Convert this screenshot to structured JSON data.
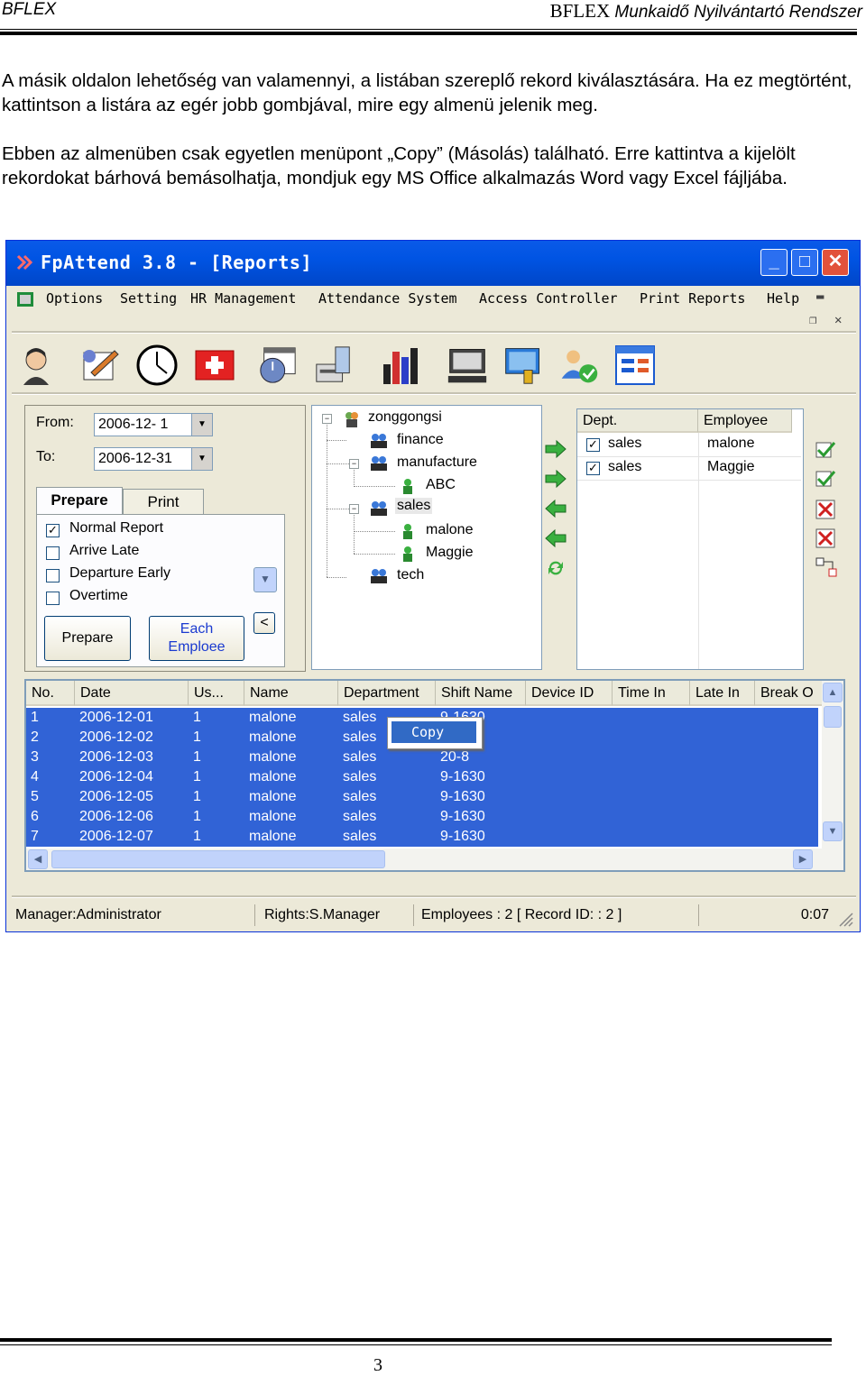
{
  "header": {
    "left": "BFLEX",
    "right_brand": "BFLEX",
    "right_sub": "Munkaidő Nyilvántartó Rendszer"
  },
  "paragraphs": [
    "A másik oldalon lehetőség van valamennyi, a listában szereplő rekord kiválasztására. Ha ez megtörtént, kattintson a listára az egér jobb gombjával, mire egy almenü jelenik meg.",
    "Ebben az almenüben csak egyetlen menüpont „Copy” (Másolás) található. Erre kattintva a kijelölt rekordokat bárhová bemásolhatja, mondjuk egy MS Office alkalmazás Word vagy Excel fájljába."
  ],
  "page_number": "3",
  "window": {
    "title": "FpAttend 3.8 - [Reports]",
    "menu": [
      "Options",
      "Setting",
      "HR Management",
      "Attendance System",
      "Access Controller",
      "Print Reports",
      "Help"
    ],
    "toolbar_icons": [
      "employee-icon",
      "edit-document-icon",
      "clock-icon",
      "first-aid-icon",
      "calendar-icon",
      "fingerprint-device-icon",
      "bar-chart-icon",
      "computer-icon",
      "network-tools-icon",
      "users-check-icon",
      "report-form-icon"
    ],
    "filter": {
      "from_label": "From:",
      "from_value": "2006-12- 1",
      "to_label": "To:",
      "to_value": "2006-12-31"
    },
    "tabs": [
      "Prepare",
      "Print"
    ],
    "report_options": [
      {
        "label": "Normal Report",
        "checked": true
      },
      {
        "label": "Arrive Late",
        "checked": false
      },
      {
        "label": "Departure Early",
        "checked": false
      },
      {
        "label": "Overtime",
        "checked": false
      }
    ],
    "buttons": {
      "prepare": "Prepare",
      "each_line1": "Each",
      "each_line2": "Emploee",
      "collapse": "<"
    },
    "tree": [
      "zonggongsi",
      "finance",
      "manufacture",
      "ABC",
      "sales",
      "malone",
      "Maggie",
      "tech"
    ],
    "dept_grid": {
      "columns": [
        "Dept.",
        "Employee"
      ],
      "rows": [
        {
          "dept": "sales",
          "employee": "malone",
          "checked": true
        },
        {
          "dept": "sales",
          "employee": "Maggie",
          "checked": true
        }
      ]
    },
    "records": {
      "columns": [
        "No.",
        "Date",
        "Us...",
        "Name",
        "Department",
        "Shift Name",
        "Device ID",
        "Time In",
        "Late In",
        "Break O"
      ],
      "rows": [
        [
          "1",
          "2006-12-01",
          "1",
          "malone",
          "sales",
          "9-1630"
        ],
        [
          "2",
          "2006-12-02",
          "1",
          "malone",
          "sales",
          ""
        ],
        [
          "3",
          "2006-12-03",
          "1",
          "malone",
          "sales",
          "20-8"
        ],
        [
          "4",
          "2006-12-04",
          "1",
          "malone",
          "sales",
          "9-1630"
        ],
        [
          "5",
          "2006-12-05",
          "1",
          "malone",
          "sales",
          "9-1630"
        ],
        [
          "6",
          "2006-12-06",
          "1",
          "malone",
          "sales",
          "9-1630"
        ],
        [
          "7",
          "2006-12-07",
          "1",
          "malone",
          "sales",
          "9-1630"
        ]
      ]
    },
    "context_menu": {
      "item": "Copy"
    },
    "status": {
      "manager": "Manager:Administrator",
      "rights": "Rights:S.Manager",
      "employees": "Employees : 2 [ Record ID: : 2 ]",
      "time": "0:07"
    },
    "colors": {
      "title_blue": "#0054e3",
      "selection": "#3163d6",
      "window_bg": "#ece9d8"
    }
  }
}
